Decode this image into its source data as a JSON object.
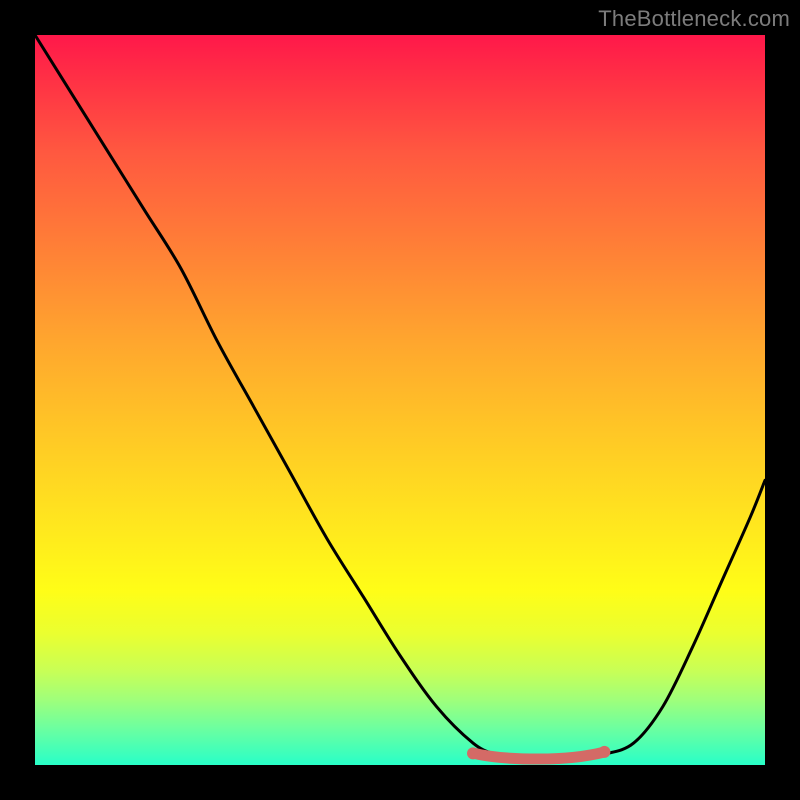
{
  "watermark": "TheBottleneck.com",
  "chart_data": {
    "type": "line",
    "title": "",
    "xlabel": "",
    "ylabel": "",
    "xlim": [
      0,
      1
    ],
    "ylim": [
      0,
      1
    ],
    "series": [
      {
        "name": "bottleneck-curve",
        "color": "#000000",
        "x": [
          0.0,
          0.05,
          0.1,
          0.15,
          0.2,
          0.25,
          0.3,
          0.35,
          0.4,
          0.45,
          0.5,
          0.55,
          0.6,
          0.63,
          0.66,
          0.7,
          0.74,
          0.78,
          0.82,
          0.86,
          0.9,
          0.94,
          0.98,
          1.0
        ],
        "y": [
          1.0,
          0.92,
          0.84,
          0.76,
          0.68,
          0.58,
          0.49,
          0.4,
          0.31,
          0.23,
          0.15,
          0.08,
          0.03,
          0.015,
          0.01,
          0.01,
          0.01,
          0.015,
          0.03,
          0.08,
          0.16,
          0.25,
          0.34,
          0.39
        ]
      },
      {
        "name": "optimal-range-band",
        "color": "#d46a66",
        "x": [
          0.6,
          0.78
        ],
        "y": [
          0.015,
          0.015
        ]
      }
    ],
    "markers": [
      {
        "name": "optimal-left-dot",
        "x": 0.6,
        "y": 0.016,
        "color": "#d46a66"
      },
      {
        "name": "optimal-right-dot",
        "x": 0.78,
        "y": 0.018,
        "color": "#d46a66"
      }
    ]
  }
}
